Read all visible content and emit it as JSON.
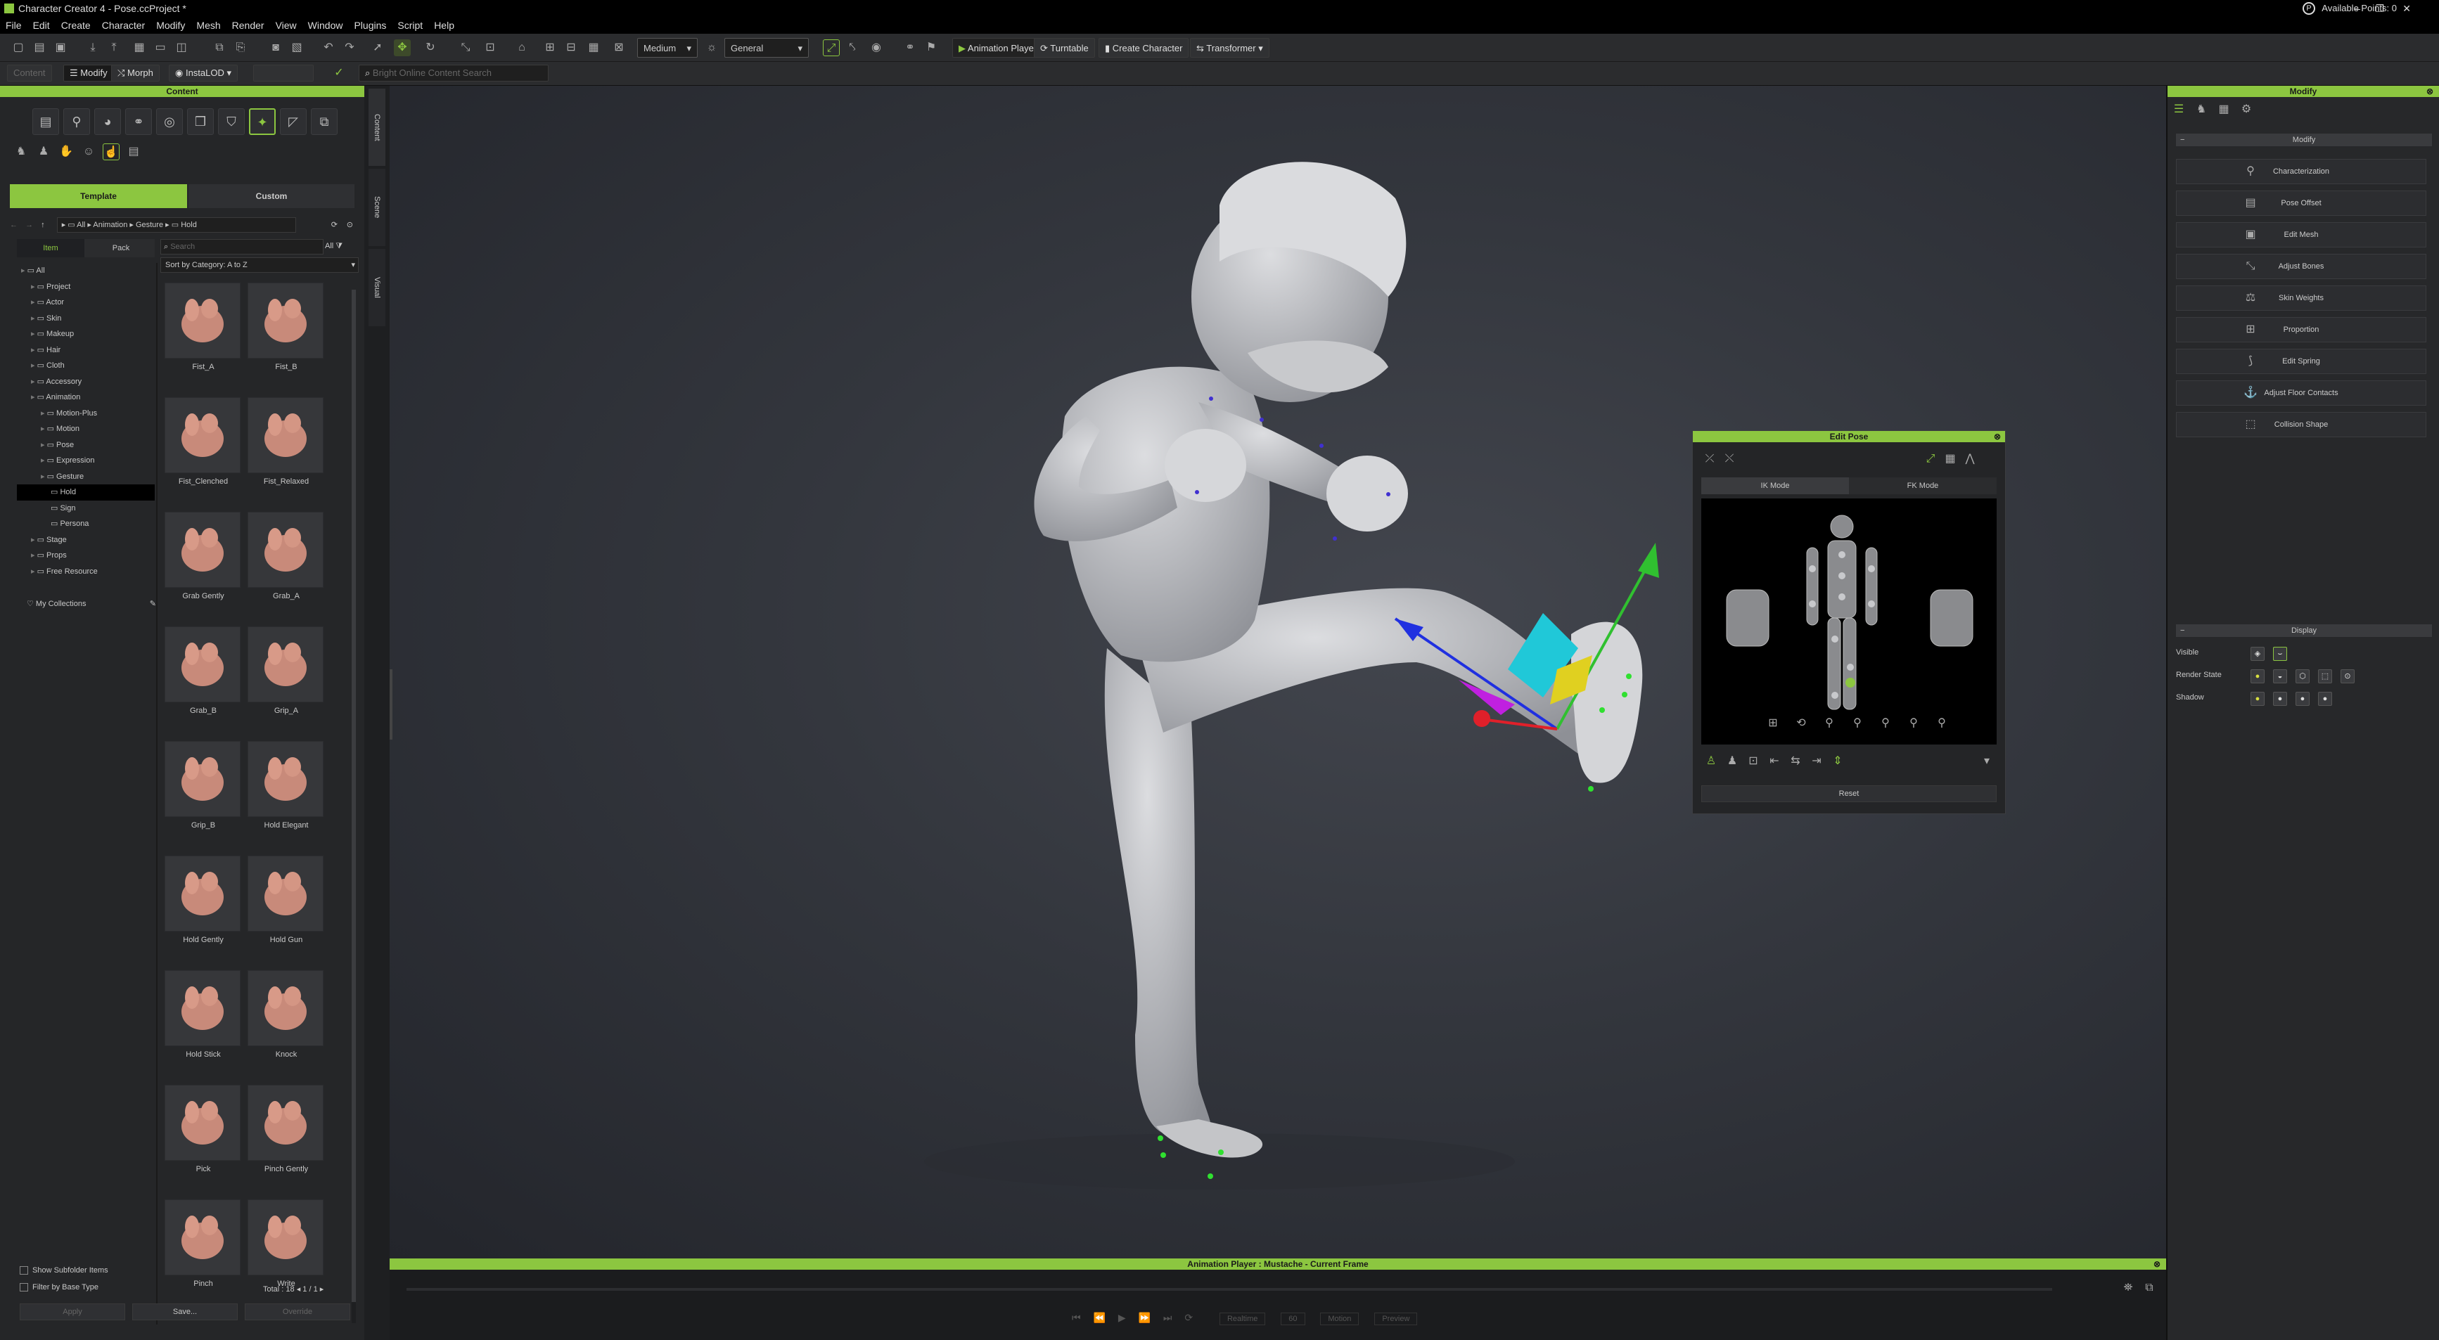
{
  "window": {
    "title": "Character Creator 4 - Pose.ccProject *",
    "available_points": "Available Points: 0"
  },
  "menu": [
    "File",
    "Edit",
    "Create",
    "Character",
    "Modify",
    "Mesh",
    "Render",
    "View",
    "Window",
    "Plugins",
    "Script",
    "Help"
  ],
  "toolbar": {
    "quality": "Medium",
    "shading": "General",
    "animation_player": "Animation Player",
    "turntable": "Turntable",
    "create_character": "Create Character",
    "transformer": "Transformer"
  },
  "toolbar2": {
    "content": "Content",
    "modify": "Modify",
    "morph": "Morph",
    "instalod": "InstaLOD",
    "search_placeholder": "Bright Online Content Search"
  },
  "content_panel": {
    "title": "Content",
    "tabs": [
      "Template",
      "Custom"
    ],
    "breadcrumb": [
      "All",
      "Animation",
      "Gesture",
      "Hold"
    ],
    "subtabs": [
      "Item",
      "Pack"
    ],
    "search_placeholder": "Search",
    "filter": "All",
    "sort": "Sort by Category: A to Z",
    "tree": [
      {
        "label": "All",
        "depth": 0
      },
      {
        "label": "Project",
        "depth": 1
      },
      {
        "label": "Actor",
        "depth": 1
      },
      {
        "label": "Skin",
        "depth": 1
      },
      {
        "label": "Makeup",
        "depth": 1
      },
      {
        "label": "Hair",
        "depth": 1
      },
      {
        "label": "Cloth",
        "depth": 1
      },
      {
        "label": "Accessory",
        "depth": 1
      },
      {
        "label": "Animation",
        "depth": 1
      },
      {
        "label": "Motion-Plus",
        "depth": 2
      },
      {
        "label": "Motion",
        "depth": 2
      },
      {
        "label": "Pose",
        "depth": 2
      },
      {
        "label": "Expression",
        "depth": 2
      },
      {
        "label": "Gesture",
        "depth": 2
      },
      {
        "label": "Hold",
        "depth": 3,
        "selected": true
      },
      {
        "label": "Sign",
        "depth": 3
      },
      {
        "label": "Persona",
        "depth": 3
      },
      {
        "label": "Stage",
        "depth": 1
      },
      {
        "label": "Props",
        "depth": 1
      },
      {
        "label": "Free Resource",
        "depth": 1
      }
    ],
    "collections": "My Collections",
    "items": [
      "Fist_A",
      "Fist_B",
      "Fist_Clenched",
      "Fist_Relaxed",
      "Grab Gently",
      "Grab_A",
      "Grab_B",
      "Grip_A",
      "Grip_B",
      "Hold Elegant",
      "Hold Gently",
      "Hold Gun",
      "Hold Stick",
      "Knock",
      "Pick",
      "Pinch Gently",
      "Pinch",
      "Write"
    ],
    "show_subfolder": "Show Subfolder Items",
    "filter_base": "Filter by Base Type",
    "total": "Total : 18",
    "page": "1 / 1",
    "bottom_buttons": [
      "Apply",
      "Save...",
      "Override"
    ]
  },
  "side_tabs": [
    "Content",
    "Scene",
    "Visual"
  ],
  "modify_panel": {
    "title": "Modify",
    "section": "Modify",
    "buttons": [
      "Characterization",
      "Pose Offset",
      "Edit Mesh",
      "Adjust Bones",
      "Skin Weights",
      "Proportion",
      "Edit Spring",
      "Adjust Floor Contacts",
      "Collision Shape"
    ],
    "display": {
      "title": "Display",
      "visible": "Visible",
      "render_state": "Render State",
      "shadow": "Shadow"
    }
  },
  "edit_pose": {
    "title": "Edit Pose",
    "modes": [
      "IK Mode",
      "FK Mode"
    ],
    "reset": "Reset"
  },
  "anim_player": {
    "title": "Animation Player : Mustache - Current Frame",
    "mode": "Realtime",
    "fps": "60",
    "option": "Motion",
    "preview": "Preview"
  },
  "colors": {
    "accent": "#8cc640",
    "gizmo_x": "#e0202a",
    "gizmo_y": "#30c030",
    "gizmo_z": "#2030e0",
    "ik_handle": "#30e030"
  }
}
